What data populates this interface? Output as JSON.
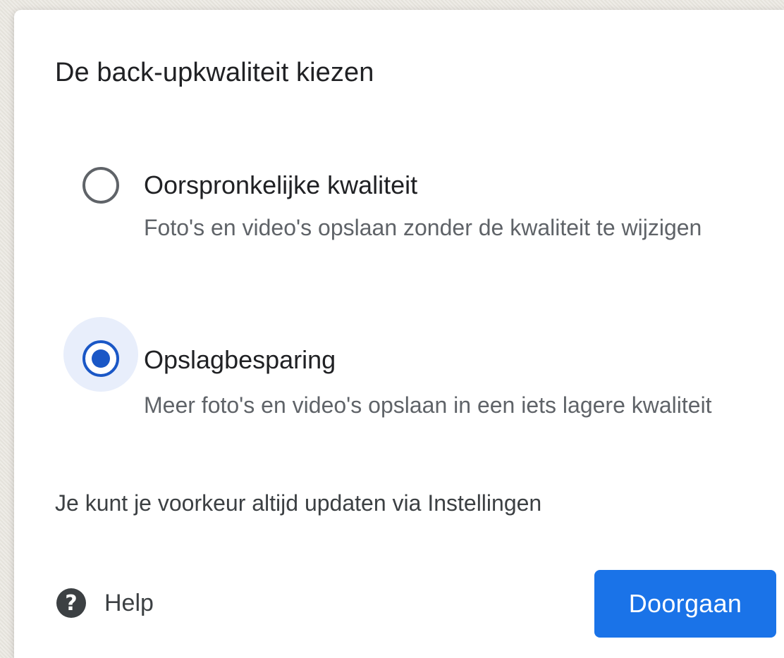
{
  "dialog": {
    "title": "De back-upkwaliteit kiezen",
    "options": [
      {
        "label": "Oorspronkelijke kwaliteit",
        "description": "Foto's en video's opslaan zonder de kwaliteit te wijzigen",
        "selected": false
      },
      {
        "label": "Opslagbesparing",
        "description": "Meer foto's en video's opslaan in een iets lagere kwaliteit",
        "selected": true
      }
    ],
    "footnote": "Je kunt je voorkeur altijd updaten via Instellingen",
    "help": {
      "icon": "help-circle-icon",
      "glyph": "?",
      "label": "Help"
    },
    "continue_label": "Doorgaan"
  },
  "colors": {
    "accent": "#1a73e8",
    "radio_selected": "#1a57c6",
    "radio_halo": "#e8eefb",
    "text_primary": "#202124",
    "text_secondary": "#5f6368"
  }
}
